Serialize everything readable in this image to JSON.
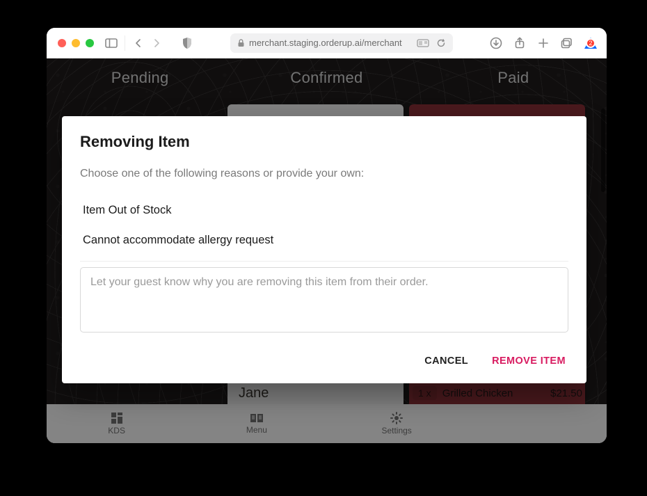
{
  "browser": {
    "url_display": "merchant.staging.orderup.ai/merchant",
    "badge_count": "2"
  },
  "tabs": {
    "pending": "Pending",
    "confirmed": "Confirmed",
    "paid": "Paid"
  },
  "bottombar": {
    "kds": "KDS",
    "menu": "Menu",
    "settings": "Settings"
  },
  "visible_order": {
    "name": "Jane",
    "qty": "1 x",
    "item": "Grilled Chicken",
    "price": "$21.50"
  },
  "dialog": {
    "title": "Removing Item",
    "lead": "Choose one of the following reasons or provide your own:",
    "options": [
      "Item Out of Stock",
      "Cannot accommodate allergy request"
    ],
    "textarea_placeholder": "Let your guest know why you are removing this item from their order.",
    "cancel": "CANCEL",
    "remove": "REMOVE ITEM"
  }
}
